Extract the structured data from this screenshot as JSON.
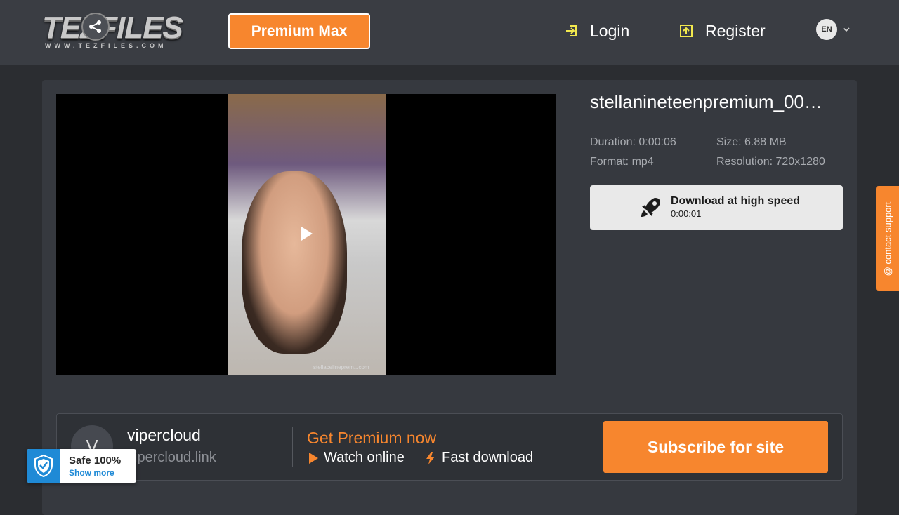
{
  "header": {
    "logo_text": "TEZFILES",
    "logo_url": "WWW.TEZFILES.COM",
    "premium_label": "Premium Max",
    "login_label": "Login",
    "register_label": "Register",
    "language": "EN"
  },
  "player": {
    "watermark": "stellacelineprem...com",
    "play_icon": "play-icon"
  },
  "file": {
    "title": "stellanineteenpremium_00…",
    "duration": "Duration: 0:00:06",
    "size": "Size: 6.88 MB",
    "format": "Format: mp4",
    "resolution": "Resolution: 720x1280"
  },
  "download": {
    "label": "Download at high speed",
    "timer": "0:00:01",
    "icon": "rocket-icon"
  },
  "support": {
    "label": "@ contact support"
  },
  "uploader": {
    "avatar_letter": "V",
    "name": "vipercloud",
    "site": "vipercloud.link"
  },
  "promo": {
    "title": "Get Premium now",
    "feature_watch": "Watch online",
    "feature_fast": "Fast download",
    "subscribe_label": "Subscribe for site"
  },
  "safe_badge": {
    "title": "Safe 100%",
    "link": "Show more"
  },
  "colors": {
    "accent": "#f7862e",
    "header_bg": "#3a3d43",
    "page_bg": "#2b2d31",
    "card_bg": "#36393f",
    "badge_blue": "#1f8ad6"
  }
}
